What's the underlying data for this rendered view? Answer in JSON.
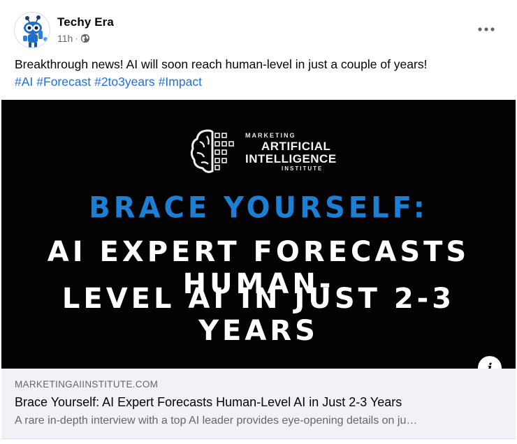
{
  "post": {
    "author": "Techy Era",
    "time": "11h",
    "separator": "·",
    "privacy_icon": "globe-icon",
    "more_icon": "more-options-icon",
    "text": "Breakthrough news! AI will soon reach human-level in just a couple of years!",
    "hashtags": [
      "#AI",
      "#Forecast",
      "#2to3years",
      "#Impact"
    ]
  },
  "link_image": {
    "logo": {
      "line1": "MARKETING",
      "line2": "ARTIFICIAL",
      "line3": "INTELLIGENCE",
      "line4": "INSTITUTE"
    },
    "headline_blue": "BRACE YOURSELF:",
    "headline_white_1": "AI EXPERT FORECASTS HUMAN-",
    "headline_white_2": "LEVEL AI IN JUST 2-3 YEARS",
    "info_icon": "i"
  },
  "link_card": {
    "domain": "MARKETINGAIINSTITUTE.COM",
    "title": "Brace Yourself: AI Expert Forecasts Human-Level AI in Just 2-3 Years",
    "description": "A rare in-depth interview with a top AI leader provides eye-opening details on ju…"
  },
  "colors": {
    "hashtag": "#216fdb",
    "headline_blue": "#1c7fd6",
    "secondary_text": "#65676b",
    "card_bg": "#f0f2f5"
  }
}
